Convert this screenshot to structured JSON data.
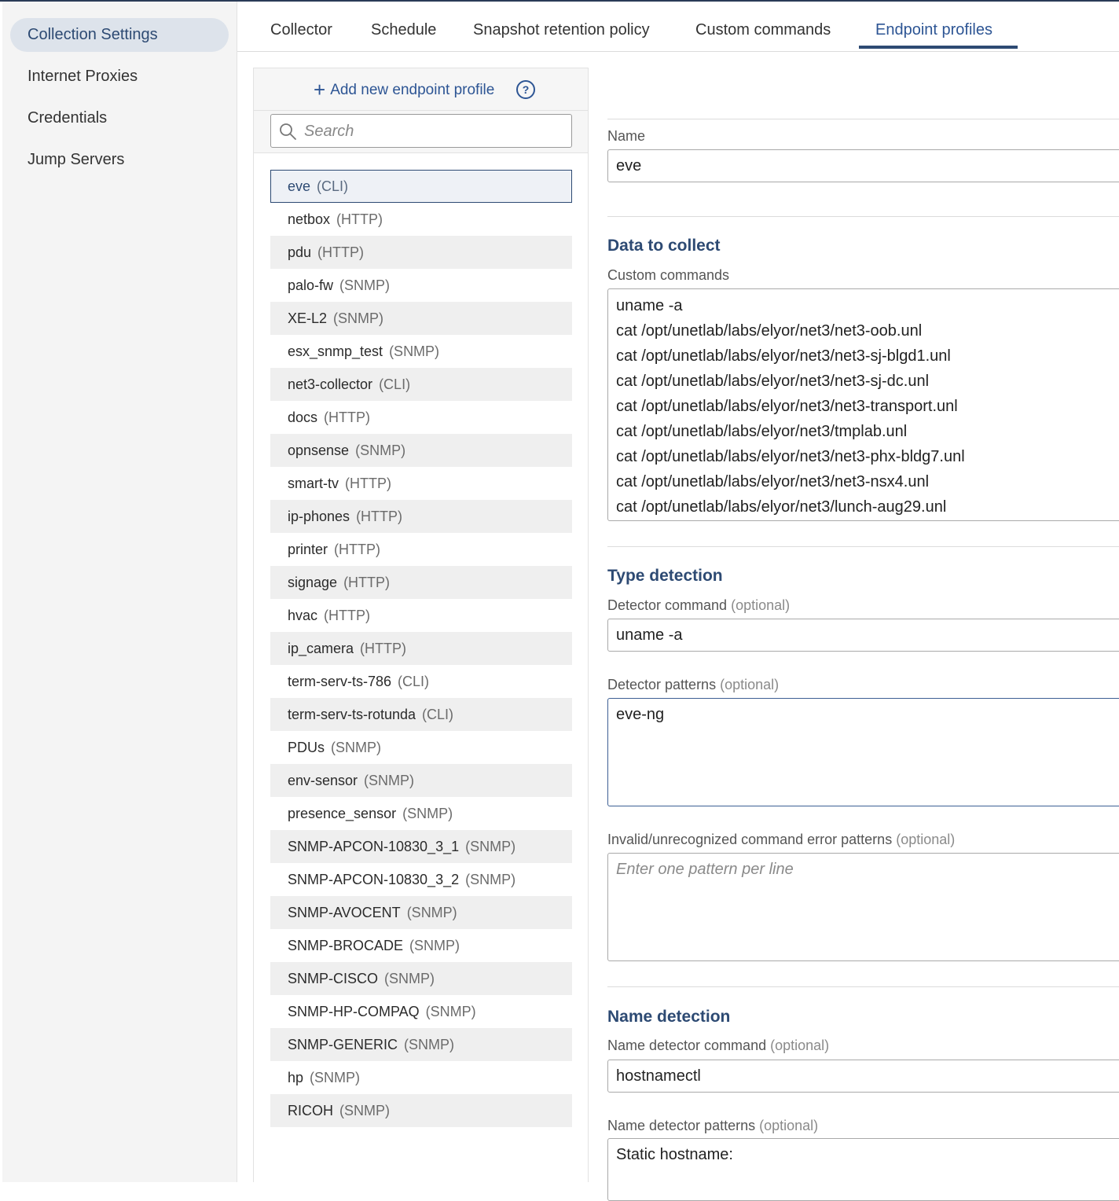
{
  "sidebar": {
    "items": [
      {
        "label": "Collection Settings",
        "active": true
      },
      {
        "label": "Internet Proxies"
      },
      {
        "label": "Credentials"
      },
      {
        "label": "Jump Servers"
      }
    ]
  },
  "tabs": [
    {
      "label": "Collector"
    },
    {
      "label": "Schedule"
    },
    {
      "label": "Snapshot retention policy"
    },
    {
      "label": "Custom commands"
    },
    {
      "label": "Endpoint profiles",
      "active": true
    }
  ],
  "list_panel": {
    "add_label": "Add new endpoint profile",
    "help_icon": "question-circle-icon",
    "search_placeholder": "Search",
    "profiles": [
      {
        "name": "eve",
        "type": "(CLI)",
        "selected": true
      },
      {
        "name": "netbox",
        "type": "(HTTP)"
      },
      {
        "name": "pdu",
        "type": "(HTTP)"
      },
      {
        "name": "palo-fw",
        "type": "(SNMP)"
      },
      {
        "name": "XE-L2",
        "type": "(SNMP)"
      },
      {
        "name": "esx_snmp_test",
        "type": "(SNMP)"
      },
      {
        "name": "net3-collector",
        "type": "(CLI)"
      },
      {
        "name": "docs",
        "type": "(HTTP)"
      },
      {
        "name": "opnsense",
        "type": "(SNMP)"
      },
      {
        "name": "smart-tv",
        "type": "(HTTP)"
      },
      {
        "name": "ip-phones",
        "type": "(HTTP)"
      },
      {
        "name": "printer",
        "type": "(HTTP)"
      },
      {
        "name": "signage",
        "type": "(HTTP)"
      },
      {
        "name": "hvac",
        "type": "(HTTP)"
      },
      {
        "name": "ip_camera",
        "type": "(HTTP)"
      },
      {
        "name": "term-serv-ts-786",
        "type": "(CLI)"
      },
      {
        "name": "term-serv-ts-rotunda",
        "type": "(CLI)"
      },
      {
        "name": "PDUs",
        "type": "(SNMP)"
      },
      {
        "name": "env-sensor",
        "type": "(SNMP)"
      },
      {
        "name": "presence_sensor",
        "type": "(SNMP)"
      },
      {
        "name": "SNMP-APCON-10830_3_1",
        "type": "(SNMP)"
      },
      {
        "name": "SNMP-APCON-10830_3_2",
        "type": "(SNMP)"
      },
      {
        "name": "SNMP-AVOCENT",
        "type": "(SNMP)"
      },
      {
        "name": "SNMP-BROCADE",
        "type": "(SNMP)"
      },
      {
        "name": "SNMP-CISCO",
        "type": "(SNMP)"
      },
      {
        "name": "SNMP-HP-COMPAQ",
        "type": "(SNMP)"
      },
      {
        "name": "SNMP-GENERIC",
        "type": "(SNMP)"
      },
      {
        "name": "hp",
        "type": "(SNMP)"
      },
      {
        "name": "RICOH",
        "type": "(SNMP)"
      }
    ]
  },
  "form": {
    "name_label": "Name",
    "name_value": "eve",
    "data_section_title": "Data to collect",
    "custom_commands_label": "Custom commands",
    "custom_commands": [
      "uname -a",
      "cat /opt/unetlab/labs/elyor/net3/net3-oob.unl",
      "cat /opt/unetlab/labs/elyor/net3/net3-sj-blgd1.unl",
      "cat /opt/unetlab/labs/elyor/net3/net3-sj-dc.unl",
      "cat /opt/unetlab/labs/elyor/net3/net3-transport.unl",
      "cat /opt/unetlab/labs/elyor/net3/tmplab.unl",
      "cat /opt/unetlab/labs/elyor/net3/net3-phx-bldg7.unl",
      "cat /opt/unetlab/labs/elyor/net3/net3-nsx4.unl",
      "cat /opt/unetlab/labs/elyor/net3/lunch-aug29.unl"
    ],
    "optional_text": "(optional)",
    "type_section_title": "Type detection",
    "detector_command_label": "Detector command",
    "detector_command_value": "uname -a",
    "detector_patterns_label": "Detector patterns",
    "detector_patterns_value": "eve-ng",
    "error_patterns_label": "Invalid/unrecognized command error patterns",
    "error_patterns_placeholder": "Enter one pattern per line",
    "name_section_title": "Name detection",
    "name_detector_command_label": "Name detector command",
    "name_detector_command_value": "hostnamectl",
    "name_detector_patterns_label": "Name detector patterns",
    "name_detector_patterns_value": "Static hostname:"
  },
  "colors": {
    "accent": "#2d4a73",
    "link": "#2d5594",
    "stripe": "#efefef"
  }
}
